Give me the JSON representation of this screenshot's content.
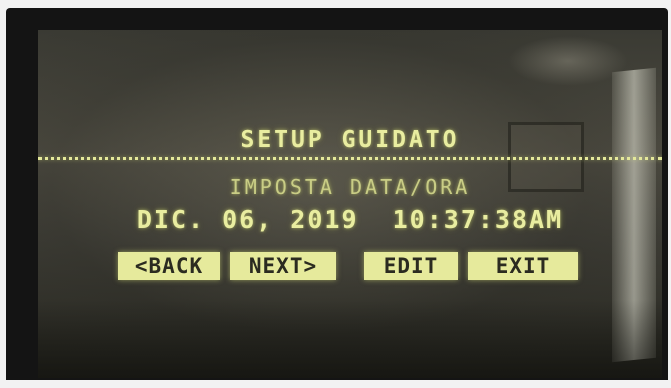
{
  "screen": {
    "title": "SETUP GUIDATO",
    "subtitle": "IMPOSTA DATA/ORA",
    "datetime": "DIC. 06, 2019  10:37:38AM"
  },
  "buttons": {
    "back": "<BACK",
    "next": "NEXT>",
    "edit": "EDIT",
    "exit": "EXIT"
  },
  "colors": {
    "lcd_text": "#e9eda0",
    "lcd_background": "#3f3e36",
    "bezel": "#141414"
  }
}
